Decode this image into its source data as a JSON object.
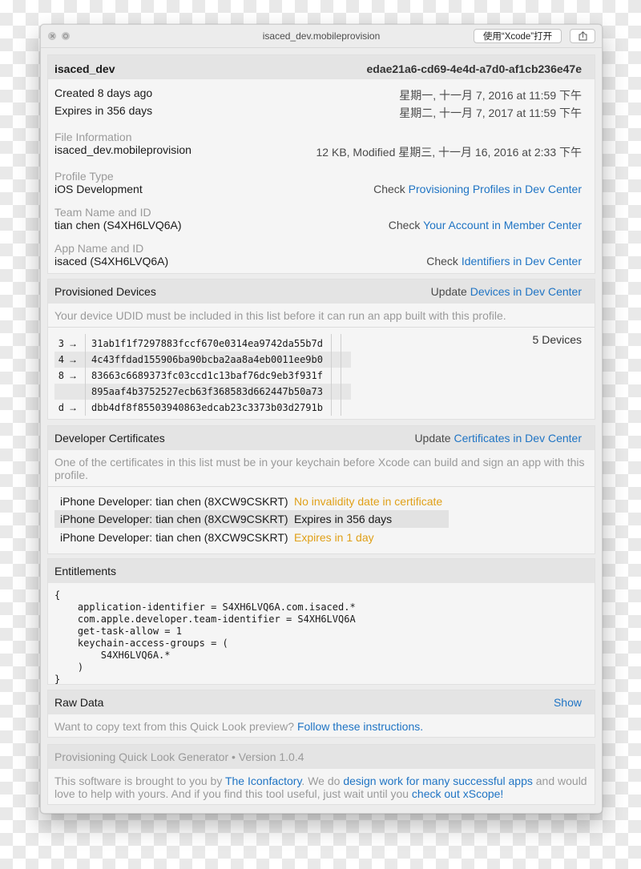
{
  "window": {
    "title": "isaced_dev.mobileprovision",
    "open_button": "使用“Xcode”打开"
  },
  "header": {
    "name": "isaced_dev",
    "uuid": "edae21a6-cd69-4e4d-a7d0-af1cb236e47e",
    "created_label": "Created 8 days ago",
    "created_date": "星期一, 十一月 7, 2016 at 11:59 下午",
    "expires_label": "Expires in 356 days",
    "expires_date": "星期二, 十一月 7, 2017 at 11:59 下午"
  },
  "info": {
    "file": {
      "label": "File Information",
      "value": "isaced_dev.mobileprovision",
      "detail": "12 KB, Modified 星期三, 十一月 16, 2016 at 2:33 下午"
    },
    "profile_type": {
      "label": "Profile Type",
      "value": "iOS Development",
      "check": "Check",
      "link": "Provisioning Profiles in Dev Center"
    },
    "team": {
      "label": "Team Name and ID",
      "value": "tian chen (S4XH6LVQ6A)",
      "check": "Check",
      "link": "Your Account in Member Center"
    },
    "app": {
      "label": "App Name and ID",
      "value": "isaced (S4XH6LVQ6A)",
      "check": "Check",
      "link": "Identifiers in Dev Center"
    }
  },
  "devices": {
    "title": "Provisioned Devices",
    "update": "Update",
    "link": "Devices in Dev Center",
    "note": "Your device UDID must be included in this list before it can run an app built with this profile.",
    "count": "5 Devices",
    "arrow": "→",
    "rows": [
      {
        "key": "3",
        "udid": "31ab1f1f7297883fccf670e0314ea9742da55b7d"
      },
      {
        "key": "4",
        "udid": "4c43ffdad155906ba90bcba2aa8a4eb0011ee9b0"
      },
      {
        "key": "8",
        "udid": "83663c6689373fc03ccd1c13baf76dc9eb3f931f"
      },
      {
        "key": "",
        "udid": "895aaf4b3752527ecb63f368583d662447b50a73"
      },
      {
        "key": "d",
        "udid": "dbb4df8f85503940863edcab23c3373b03d2791b"
      }
    ]
  },
  "certificates": {
    "title": "Developer Certificates",
    "update": "Update",
    "link": "Certificates in Dev Center",
    "note": "One of the certificates in this list must be in your keychain before Xcode can build and sign an app with this profile.",
    "rows": [
      {
        "name": "iPhone Developer: tian chen (8XCW9CSKRT)",
        "status": "No invalidity date in certificate",
        "status_color": "#e0a018"
      },
      {
        "name": "iPhone Developer: tian chen (8XCW9CSKRT)",
        "status": "Expires in 356 days",
        "status_color": "#1a1a1a"
      },
      {
        "name": "iPhone Developer: tian chen (8XCW9CSKRT)",
        "status": "Expires in 1 day",
        "status_color": "#e0a018"
      }
    ]
  },
  "entitlements": {
    "title": "Entitlements",
    "code": "{\n    application-identifier = S4XH6LVQ6A.com.isaced.*\n    com.apple.developer.team-identifier = S4XH6LVQ6A\n    get-task-allow = 1\n    keychain-access-groups = (\n        S4XH6LVQ6A.*\n    )\n}"
  },
  "raw_data": {
    "title": "Raw Data",
    "show": "Show",
    "note_prefix": "Want to copy text from this Quick Look preview?",
    "note_link": "Follow these instructions."
  },
  "footer": {
    "title": "Provisioning Quick Look Generator • Version 1.0.4",
    "t1": "This software is brought to you by",
    "l1": "The Iconfactory",
    "t2": ". We do",
    "l2": "design work for many successful apps",
    "t3": "and would love to help with yours. And if you find this tool useful, just wait until you",
    "l3": "check out xScope!"
  }
}
